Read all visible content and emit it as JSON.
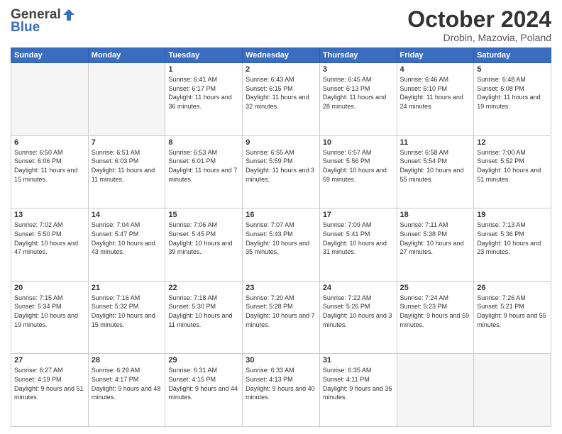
{
  "header": {
    "logo_general": "General",
    "logo_blue": "Blue",
    "title": "October 2024",
    "location": "Drobin, Mazovia, Poland"
  },
  "weekdays": [
    "Sunday",
    "Monday",
    "Tuesday",
    "Wednesday",
    "Thursday",
    "Friday",
    "Saturday"
  ],
  "weeks": [
    [
      {
        "day": "",
        "empty": true
      },
      {
        "day": "",
        "empty": true
      },
      {
        "day": "1",
        "sunrise": "6:41 AM",
        "sunset": "6:17 PM",
        "daylight": "11 hours and 36 minutes."
      },
      {
        "day": "2",
        "sunrise": "6:43 AM",
        "sunset": "6:15 PM",
        "daylight": "11 hours and 32 minutes."
      },
      {
        "day": "3",
        "sunrise": "6:45 AM",
        "sunset": "6:13 PM",
        "daylight": "11 hours and 28 minutes."
      },
      {
        "day": "4",
        "sunrise": "6:46 AM",
        "sunset": "6:10 PM",
        "daylight": "11 hours and 24 minutes."
      },
      {
        "day": "5",
        "sunrise": "6:48 AM",
        "sunset": "6:08 PM",
        "daylight": "11 hours and 19 minutes."
      }
    ],
    [
      {
        "day": "6",
        "sunrise": "6:50 AM",
        "sunset": "6:06 PM",
        "daylight": "11 hours and 15 minutes."
      },
      {
        "day": "7",
        "sunrise": "6:51 AM",
        "sunset": "6:03 PM",
        "daylight": "11 hours and 11 minutes."
      },
      {
        "day": "8",
        "sunrise": "6:53 AM",
        "sunset": "6:01 PM",
        "daylight": "11 hours and 7 minutes."
      },
      {
        "day": "9",
        "sunrise": "6:55 AM",
        "sunset": "5:59 PM",
        "daylight": "11 hours and 3 minutes."
      },
      {
        "day": "10",
        "sunrise": "6:57 AM",
        "sunset": "5:56 PM",
        "daylight": "10 hours and 59 minutes."
      },
      {
        "day": "11",
        "sunrise": "6:58 AM",
        "sunset": "5:54 PM",
        "daylight": "10 hours and 55 minutes."
      },
      {
        "day": "12",
        "sunrise": "7:00 AM",
        "sunset": "5:52 PM",
        "daylight": "10 hours and 51 minutes."
      }
    ],
    [
      {
        "day": "13",
        "sunrise": "7:02 AM",
        "sunset": "5:50 PM",
        "daylight": "10 hours and 47 minutes."
      },
      {
        "day": "14",
        "sunrise": "7:04 AM",
        "sunset": "5:47 PM",
        "daylight": "10 hours and 43 minutes."
      },
      {
        "day": "15",
        "sunrise": "7:06 AM",
        "sunset": "5:45 PM",
        "daylight": "10 hours and 39 minutes."
      },
      {
        "day": "16",
        "sunrise": "7:07 AM",
        "sunset": "5:43 PM",
        "daylight": "10 hours and 35 minutes."
      },
      {
        "day": "17",
        "sunrise": "7:09 AM",
        "sunset": "5:41 PM",
        "daylight": "10 hours and 31 minutes."
      },
      {
        "day": "18",
        "sunrise": "7:11 AM",
        "sunset": "5:38 PM",
        "daylight": "10 hours and 27 minutes."
      },
      {
        "day": "19",
        "sunrise": "7:13 AM",
        "sunset": "5:36 PM",
        "daylight": "10 hours and 23 minutes."
      }
    ],
    [
      {
        "day": "20",
        "sunrise": "7:15 AM",
        "sunset": "5:34 PM",
        "daylight": "10 hours and 19 minutes."
      },
      {
        "day": "21",
        "sunrise": "7:16 AM",
        "sunset": "5:32 PM",
        "daylight": "10 hours and 15 minutes."
      },
      {
        "day": "22",
        "sunrise": "7:18 AM",
        "sunset": "5:30 PM",
        "daylight": "10 hours and 11 minutes."
      },
      {
        "day": "23",
        "sunrise": "7:20 AM",
        "sunset": "5:28 PM",
        "daylight": "10 hours and 7 minutes."
      },
      {
        "day": "24",
        "sunrise": "7:22 AM",
        "sunset": "5:26 PM",
        "daylight": "10 hours and 3 minutes."
      },
      {
        "day": "25",
        "sunrise": "7:24 AM",
        "sunset": "5:23 PM",
        "daylight": "9 hours and 59 minutes."
      },
      {
        "day": "26",
        "sunrise": "7:26 AM",
        "sunset": "5:21 PM",
        "daylight": "9 hours and 55 minutes."
      }
    ],
    [
      {
        "day": "27",
        "sunrise": "6:27 AM",
        "sunset": "4:19 PM",
        "daylight": "9 hours and 51 minutes."
      },
      {
        "day": "28",
        "sunrise": "6:29 AM",
        "sunset": "4:17 PM",
        "daylight": "9 hours and 48 minutes."
      },
      {
        "day": "29",
        "sunrise": "6:31 AM",
        "sunset": "4:15 PM",
        "daylight": "9 hours and 44 minutes."
      },
      {
        "day": "30",
        "sunrise": "6:33 AM",
        "sunset": "4:13 PM",
        "daylight": "9 hours and 40 minutes."
      },
      {
        "day": "31",
        "sunrise": "6:35 AM",
        "sunset": "4:11 PM",
        "daylight": "9 hours and 36 minutes."
      },
      {
        "day": "",
        "empty": true
      },
      {
        "day": "",
        "empty": true
      }
    ]
  ]
}
